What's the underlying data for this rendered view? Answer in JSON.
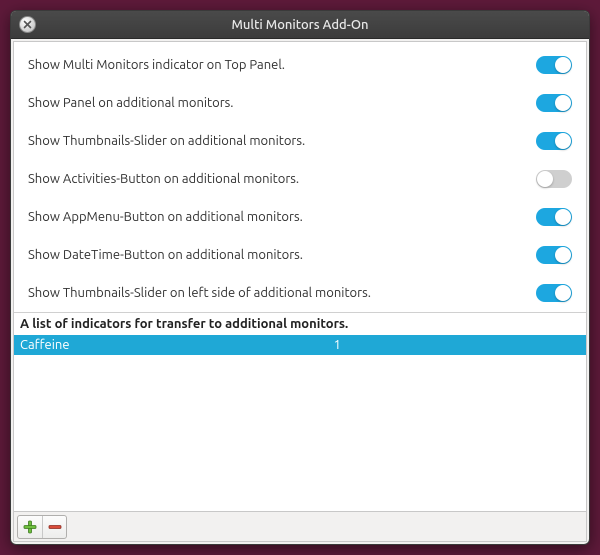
{
  "window": {
    "title": "Multi Monitors Add-On"
  },
  "settings": [
    {
      "label": "Show Multi Monitors indicator on Top Panel.",
      "value": true
    },
    {
      "label": "Show Panel on additional monitors.",
      "value": true
    },
    {
      "label": "Show Thumbnails-Slider on additional monitors.",
      "value": true
    },
    {
      "label": "Show Activities-Button on additional monitors.",
      "value": false
    },
    {
      "label": "Show AppMenu-Button on additional monitors.",
      "value": true
    },
    {
      "label": "Show DateTime-Button on additional monitors.",
      "value": true
    },
    {
      "label": "Show Thumbnails-Slider on left side of additional monitors.",
      "value": true
    }
  ],
  "indicators": {
    "header": "A list of indicators for transfer to additional monitors.",
    "rows": [
      {
        "name": "Caffeine",
        "count": "1"
      }
    ]
  },
  "icons": {
    "close": "close-icon",
    "add": "plus-icon",
    "remove": "minus-icon"
  }
}
